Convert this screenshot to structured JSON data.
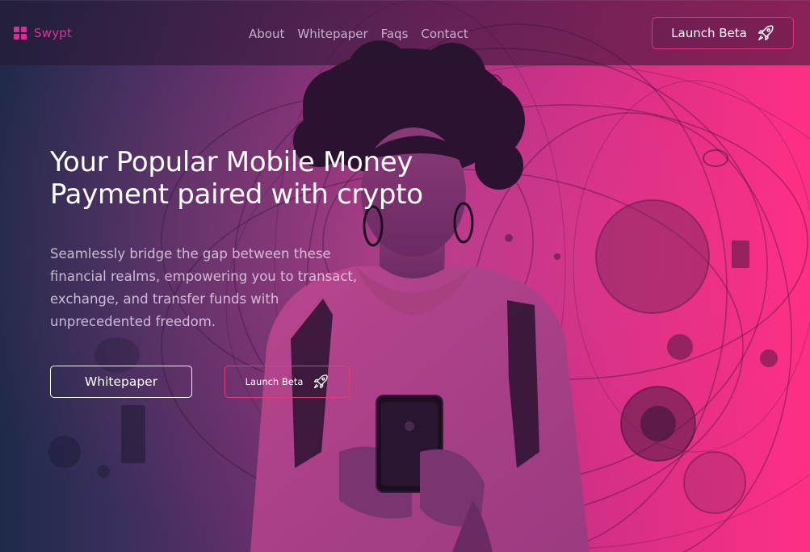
{
  "nav": {
    "brand": "Swypt",
    "links": [
      "About",
      "Whitepaper",
      "Faqs",
      "Contact"
    ],
    "cta_label": "Launch Beta",
    "cta_icon": "rocket-icon"
  },
  "hero": {
    "title": "Your Popular Mobile Money Payment paired with crypto",
    "subtitle": "Seamlessly bridge the gap between these financial realms, empowering you to transact, exchange, and transfer funds with unprecedented freedom.",
    "primary_button": "Whitepaper",
    "secondary_button": "Launch Beta",
    "secondary_icon": "rocket-icon"
  },
  "colors": {
    "brand": "#e0309c",
    "accent_border": "#e8307e",
    "gradient_left": "#1e2a4a",
    "gradient_right": "#ff2f85"
  }
}
